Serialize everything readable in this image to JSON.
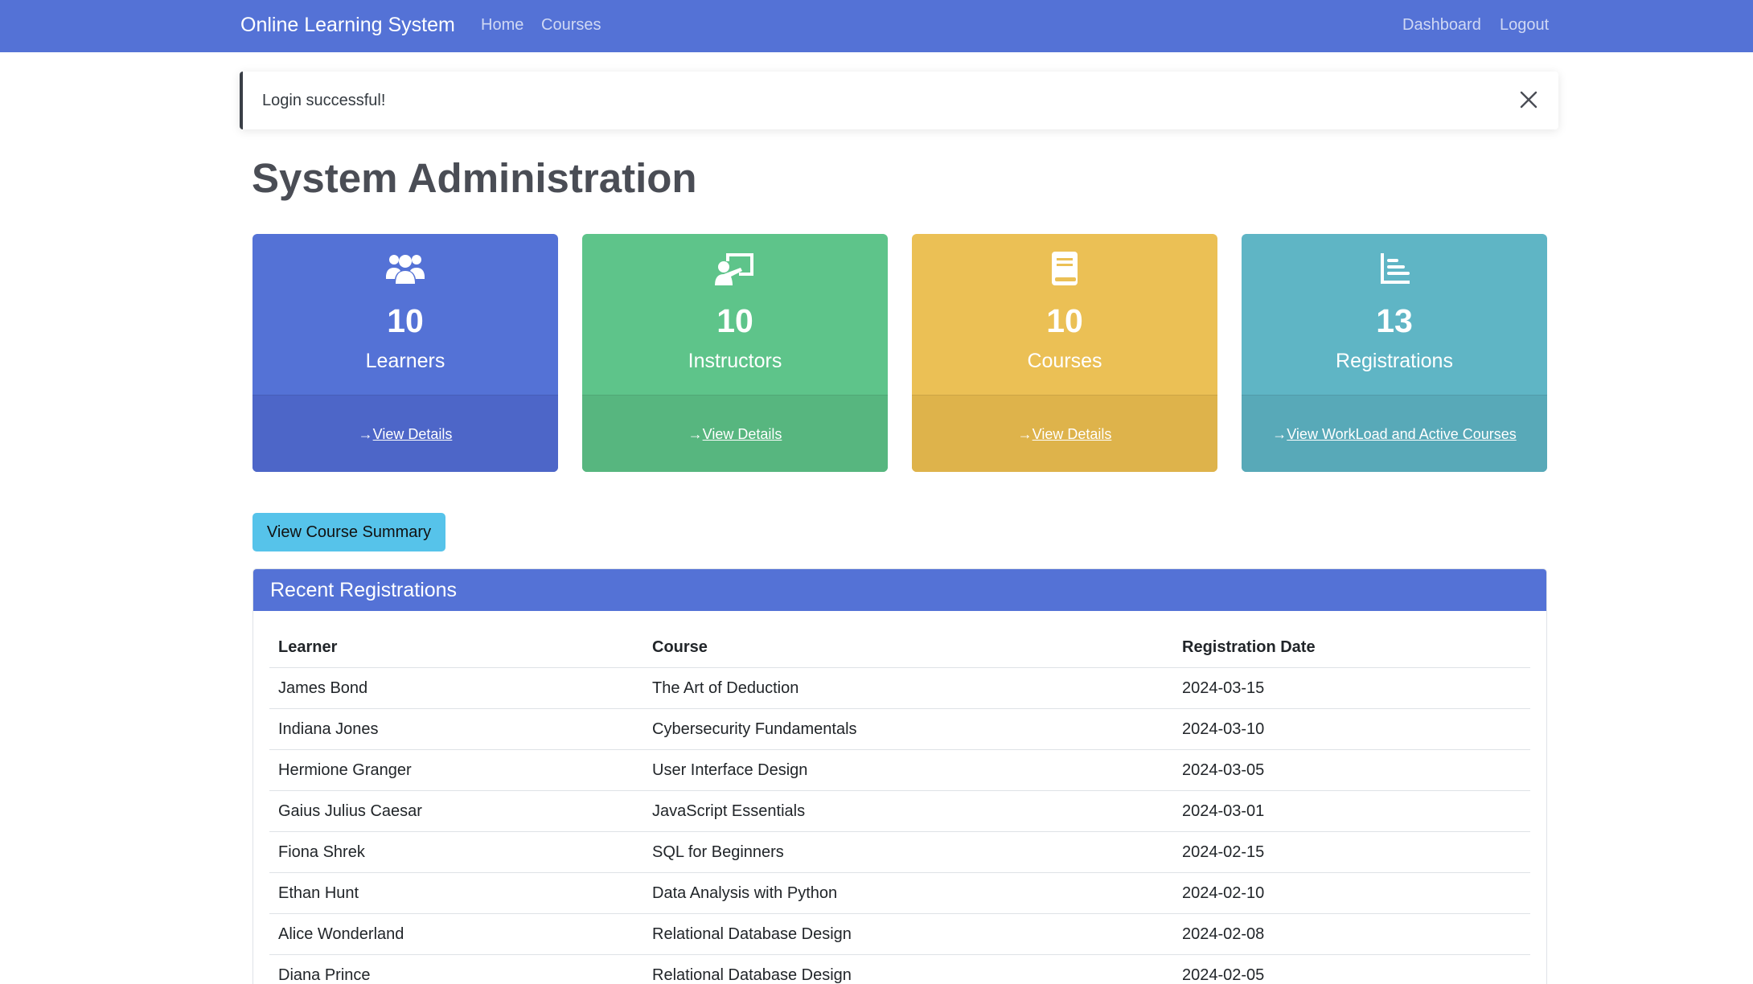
{
  "navbar": {
    "brand": "Online Learning System",
    "links": [
      "Home",
      "Courses"
    ],
    "right_links": [
      "Dashboard",
      "Logout"
    ],
    "color": "#5472d6"
  },
  "alert": {
    "message": "Login successful!",
    "close_icon": "close-icon"
  },
  "page_title": "System Administration",
  "cards": [
    {
      "value": "10",
      "label": "Learners",
      "link": "View Details",
      "icon": "users-icon",
      "color": "#5472d6"
    },
    {
      "value": "10",
      "label": "Instructors",
      "link": "View Details",
      "icon": "chalkboard-teacher-icon",
      "color": "#5ec48a"
    },
    {
      "value": "10",
      "label": "Courses",
      "link": "View Details",
      "icon": "book-icon",
      "color": "#ebc055"
    },
    {
      "value": "13",
      "label": "Registrations",
      "link": "View WorkLoad and Active Courses",
      "icon": "chart-bar-icon",
      "color": "#5fb5c5"
    }
  ],
  "summary_button": "View Course Summary",
  "registrations": {
    "title": "Recent Registrations",
    "columns": [
      "Learner",
      "Course",
      "Registration Date"
    ],
    "rows": [
      [
        "James Bond",
        "The Art of Deduction",
        "2024-03-15"
      ],
      [
        "Indiana Jones",
        "Cybersecurity Fundamentals",
        "2024-03-10"
      ],
      [
        "Hermione Granger",
        "User Interface Design",
        "2024-03-05"
      ],
      [
        "Gaius Julius Caesar",
        "JavaScript Essentials",
        "2024-03-01"
      ],
      [
        "Fiona Shrek",
        "SQL for Beginners",
        "2024-02-15"
      ],
      [
        "Ethan Hunt",
        "Data Analysis with Python",
        "2024-02-10"
      ],
      [
        "Alice Wonderland",
        "Relational Database Design",
        "2024-02-08"
      ],
      [
        "Diana Prince",
        "Relational Database Design",
        "2024-02-05"
      ]
    ]
  }
}
